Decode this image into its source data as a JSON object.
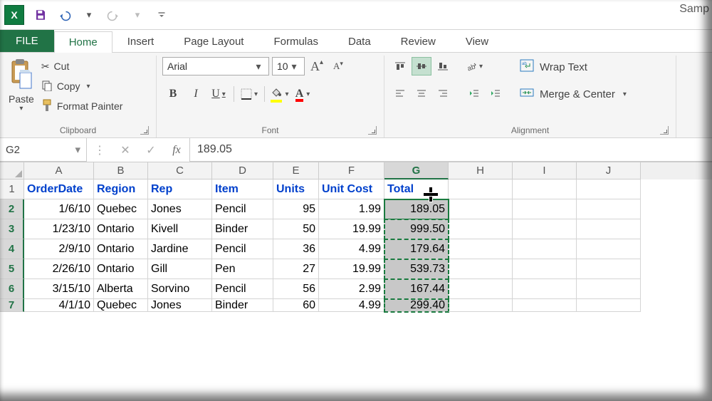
{
  "title": "Samp",
  "tabs": {
    "file": "FILE",
    "list": [
      "Home",
      "Insert",
      "Page Layout",
      "Formulas",
      "Data",
      "Review",
      "View"
    ],
    "active": "Home"
  },
  "clipboard": {
    "paste": "Paste",
    "cut": "Cut",
    "copy": "Copy",
    "format_painter": "Format Painter",
    "group_label": "Clipboard"
  },
  "font": {
    "name": "Arial",
    "size": "10",
    "group_label": "Font",
    "fill_color": "#ffff00",
    "font_color": "#ff0000"
  },
  "alignment": {
    "wrap": "Wrap Text",
    "merge": "Merge & Center",
    "group_label": "Alignment"
  },
  "formula_bar": {
    "name_box": "G2",
    "value": "189.05"
  },
  "columns": [
    "A",
    "B",
    "C",
    "D",
    "E",
    "F",
    "G",
    "H",
    "I",
    "J"
  ],
  "selected_column": "G",
  "headers": [
    "OrderDate",
    "Region",
    "Rep",
    "Item",
    "Units",
    "Unit Cost",
    "Total"
  ],
  "rows": [
    {
      "n": 2,
      "OrderDate": "1/6/10",
      "Region": "Quebec",
      "Rep": "Jones",
      "Item": "Pencil",
      "Units": "95",
      "UnitCost": "1.99",
      "Total": "189.05"
    },
    {
      "n": 3,
      "OrderDate": "1/23/10",
      "Region": "Ontario",
      "Rep": "Kivell",
      "Item": "Binder",
      "Units": "50",
      "UnitCost": "19.99",
      "Total": "999.50"
    },
    {
      "n": 4,
      "OrderDate": "2/9/10",
      "Region": "Ontario",
      "Rep": "Jardine",
      "Item": "Pencil",
      "Units": "36",
      "UnitCost": "4.99",
      "Total": "179.64"
    },
    {
      "n": 5,
      "OrderDate": "2/26/10",
      "Region": "Ontario",
      "Rep": "Gill",
      "Item": "Pen",
      "Units": "27",
      "UnitCost": "19.99",
      "Total": "539.73"
    },
    {
      "n": 6,
      "OrderDate": "3/15/10",
      "Region": "Alberta",
      "Rep": "Sorvino",
      "Item": "Pencil",
      "Units": "56",
      "UnitCost": "2.99",
      "Total": "167.44"
    },
    {
      "n": 7,
      "OrderDate": "4/1/10",
      "Region": "Quebec",
      "Rep": "Jones",
      "Item": "Binder",
      "Units": "60",
      "UnitCost": "4.99",
      "Total": "299.40"
    }
  ],
  "selection": {
    "active": "G2",
    "range_start": "G2",
    "range_end": "G7"
  }
}
